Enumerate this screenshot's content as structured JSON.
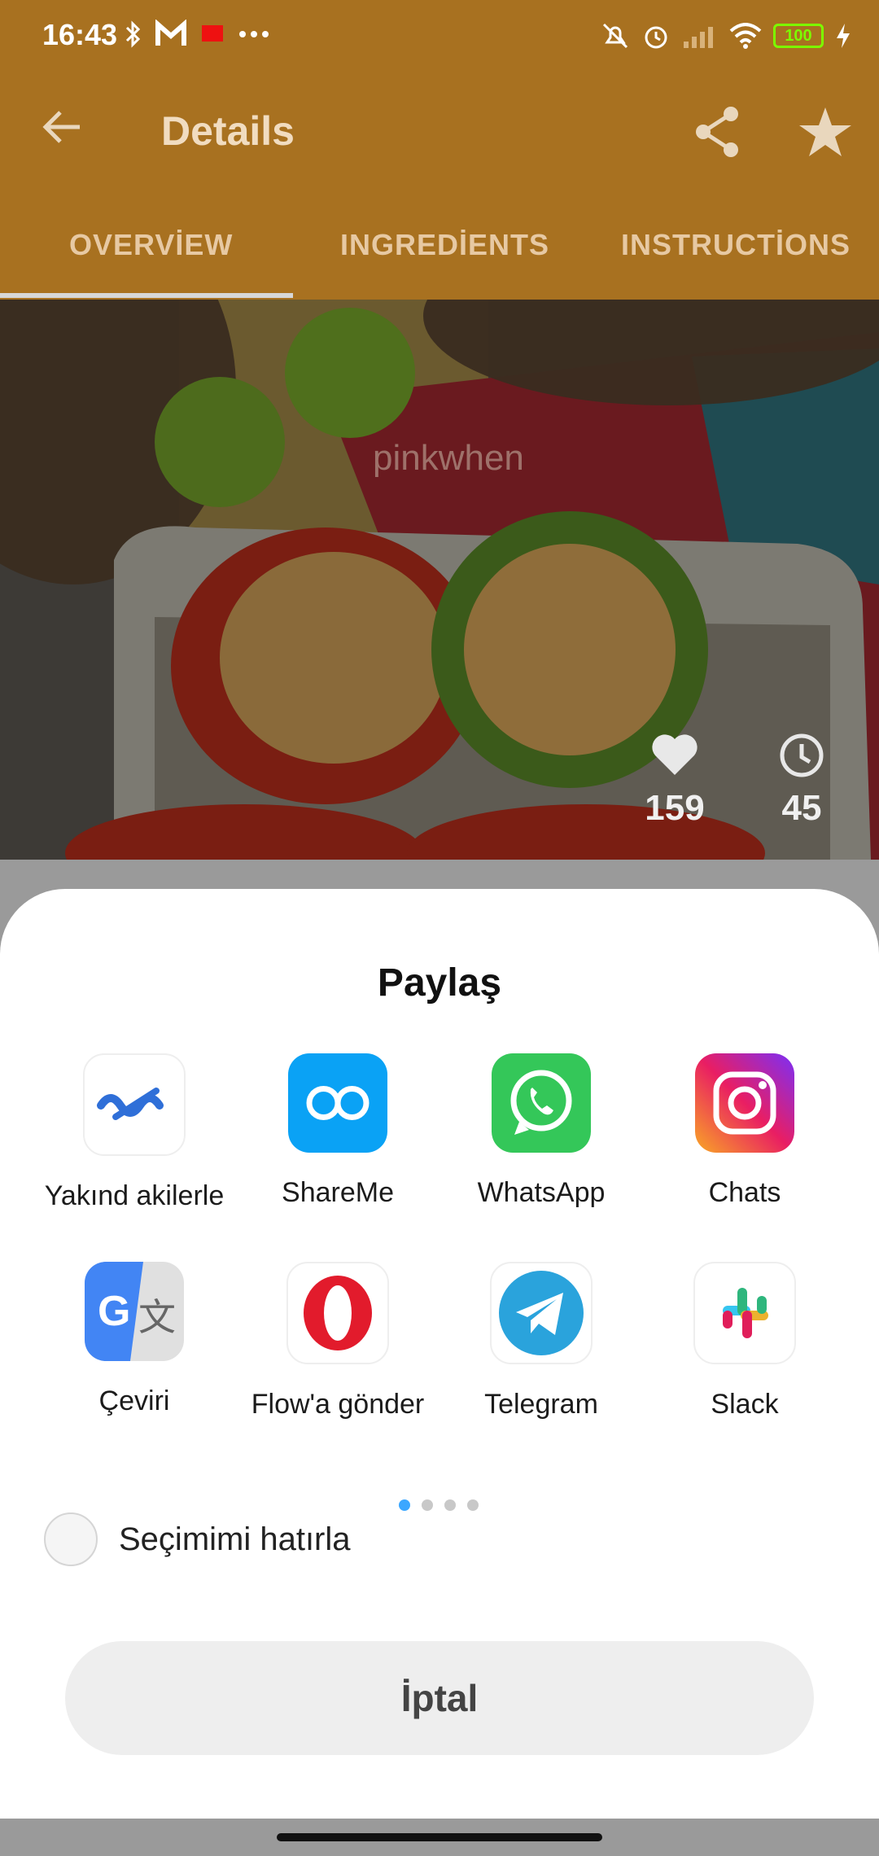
{
  "status": {
    "time": "16:43",
    "left_icons": [
      "bluetooth-icon",
      "gmail-icon",
      "notification-icon",
      "more-dots-icon"
    ],
    "right_icons": [
      "do-not-disturb-icon",
      "alarm-icon",
      "signal-icon",
      "wifi-icon",
      "battery-icon",
      "charging-icon"
    ],
    "battery": "100"
  },
  "appbar": {
    "title": "Details",
    "back_icon": "arrow-left-icon",
    "share_icon": "share-icon",
    "favorite_icon": "star-icon"
  },
  "tabs": [
    "OVERVİEW",
    "INGREDİENTS",
    "INSTRUCTİONS"
  ],
  "hero": {
    "watermark": "pinkwhen",
    "likes": "159",
    "time": "45"
  },
  "share_sheet": {
    "title": "Paylaş",
    "apps": [
      {
        "label": "Yakınd akilerle",
        "icon": "nearby-share-icon"
      },
      {
        "label": "ShareMe",
        "icon": "shareme-icon"
      },
      {
        "label": "WhatsApp",
        "icon": "whatsapp-icon"
      },
      {
        "label": "Chats",
        "icon": "instagram-icon"
      },
      {
        "label": "Çeviri",
        "icon": "google-translate-icon"
      },
      {
        "label": "Flow'a gönder",
        "icon": "opera-icon"
      },
      {
        "label": "Telegram",
        "icon": "telegram-icon"
      },
      {
        "label": "Slack",
        "icon": "slack-icon"
      }
    ],
    "page_count": 4,
    "active_page": 1,
    "remember_label": "Seçimimi hatırla",
    "cancel_label": "İptal"
  },
  "colors": {
    "appbar": "#a87120",
    "active_dot": "#3ba7ff"
  }
}
